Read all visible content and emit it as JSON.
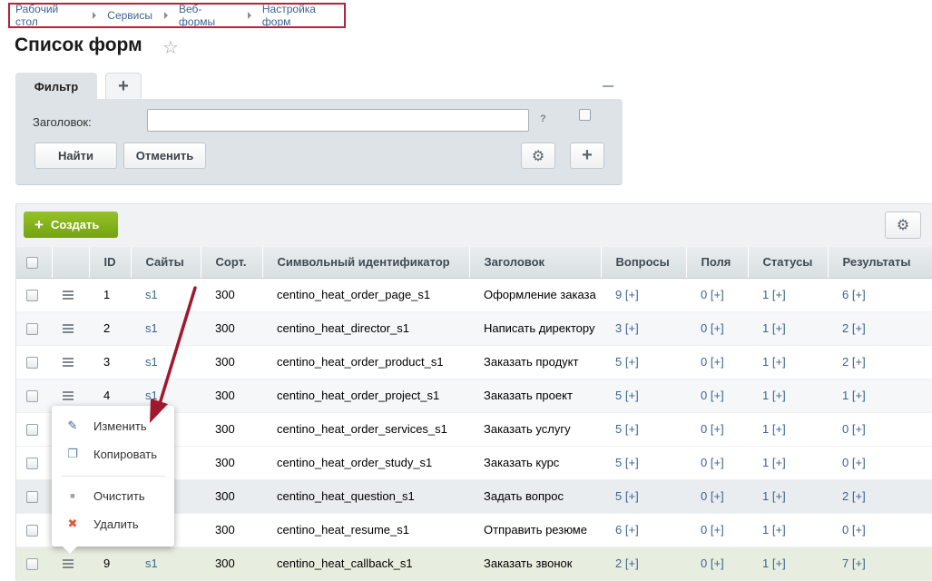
{
  "breadcrumb": [
    "Рабочий стол",
    "Сервисы",
    "Веб-формы",
    "Настройка форм"
  ],
  "page_title": "Список форм",
  "filter": {
    "tab_label": "Фильтр",
    "field_label": "Заголовок:",
    "field_value": "",
    "help": "?",
    "find_label": "Найти",
    "cancel_label": "Отменить"
  },
  "toolbar": {
    "create_label": "Создать"
  },
  "columns": [
    "ID",
    "Сайты",
    "Сорт.",
    "Символьный идентификатор",
    "Заголовок",
    "Вопросы",
    "Поля",
    "Статусы",
    "Результаты"
  ],
  "rows": [
    {
      "id": "1",
      "site": "s1",
      "sort": "300",
      "code": "centino_heat_order_page_s1",
      "title": "Оформление заказа",
      "q": "9",
      "f": "0",
      "s": "1",
      "r": "6"
    },
    {
      "id": "2",
      "site": "s1",
      "sort": "300",
      "code": "centino_heat_director_s1",
      "title": "Написать директору",
      "q": "3",
      "f": "0",
      "s": "1",
      "r": "2"
    },
    {
      "id": "3",
      "site": "s1",
      "sort": "300",
      "code": "centino_heat_order_product_s1",
      "title": "Заказать продукт",
      "q": "5",
      "f": "0",
      "s": "1",
      "r": "2"
    },
    {
      "id": "4",
      "site": "s1",
      "sort": "300",
      "code": "centino_heat_order_project_s1",
      "title": "Заказать проект",
      "q": "5",
      "f": "0",
      "s": "1",
      "r": "1"
    },
    {
      "id": "",
      "site": "",
      "sort": "300",
      "code": "centino_heat_order_services_s1",
      "title": "Заказать услугу",
      "q": "5",
      "f": "0",
      "s": "1",
      "r": "0"
    },
    {
      "id": "",
      "site": "",
      "sort": "300",
      "code": "centino_heat_order_study_s1",
      "title": "Заказать курс",
      "q": "5",
      "f": "0",
      "s": "1",
      "r": "0"
    },
    {
      "id": "",
      "site": "",
      "sort": "300",
      "code": "centino_heat_question_s1",
      "title": "Задать вопрос",
      "q": "5",
      "f": "0",
      "s": "1",
      "r": "2"
    },
    {
      "id": "",
      "site": "",
      "sort": "300",
      "code": "centino_heat_resume_s1",
      "title": "Отправить резюме",
      "q": "6",
      "f": "0",
      "s": "1",
      "r": "0"
    },
    {
      "id": "9",
      "site": "s1",
      "sort": "300",
      "code": "centino_heat_callback_s1",
      "title": "Заказать звонок",
      "q": "2",
      "f": "0",
      "s": "1",
      "r": "7"
    }
  ],
  "add_marker": "[+]",
  "context_menu": [
    "Изменить",
    "Копировать",
    "Очистить",
    "Удалить"
  ],
  "colors": {
    "link": "#3d6591",
    "create": "#82b21b",
    "arrow": "#a0182d",
    "breadcrumb_border": "#b8213b"
  }
}
